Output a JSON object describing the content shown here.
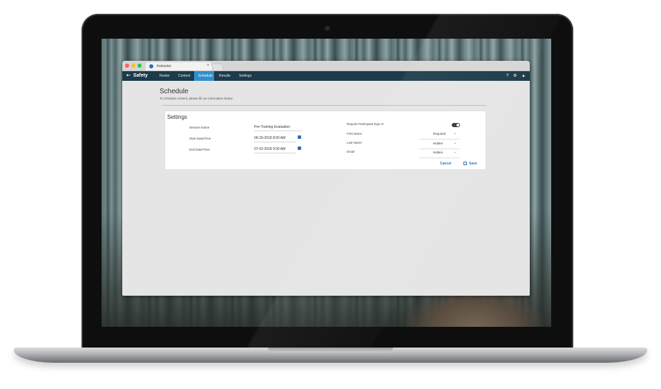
{
  "browser": {
    "tab_title": "Instructor",
    "tab_close": "×",
    "dot_colors": [
      "#ff5f57",
      "#febc2e",
      "#28c840"
    ]
  },
  "navbar": {
    "brand": "Safety",
    "brand_icon": "⇠",
    "items": [
      "Roster",
      "Content",
      "Schedule",
      "Results",
      "Settings"
    ],
    "active": "Schedule",
    "help_icon": "?",
    "gear_icon": "⚙",
    "user_icon": "▲",
    "accent": "#2f8fcf",
    "bar_color": "#1d3b4a"
  },
  "page": {
    "title": "Schedule",
    "subtitle": "To schedule content, please fill our information below:"
  },
  "settings": {
    "title": "Settings",
    "session_name_label": "Session Name",
    "session_name_value": "Pre-Training Evaluation",
    "start_label": "Start Date/Time",
    "start_value": "06-29-2018 8:00 AM",
    "end_label": "End Date/Time",
    "end_value": "07-02-2018 9:00 AM",
    "require_signin_label": "Require Participant Sign In",
    "require_signin_on": true,
    "first_name_label": "First Name",
    "first_name_value": "Required",
    "last_name_label": "Last Name",
    "last_name_value": "Hidden",
    "email_label": "Email",
    "email_value": "Hidden",
    "chevron": "⌄",
    "cancel_label": "Cancel",
    "save_label": "Save"
  }
}
